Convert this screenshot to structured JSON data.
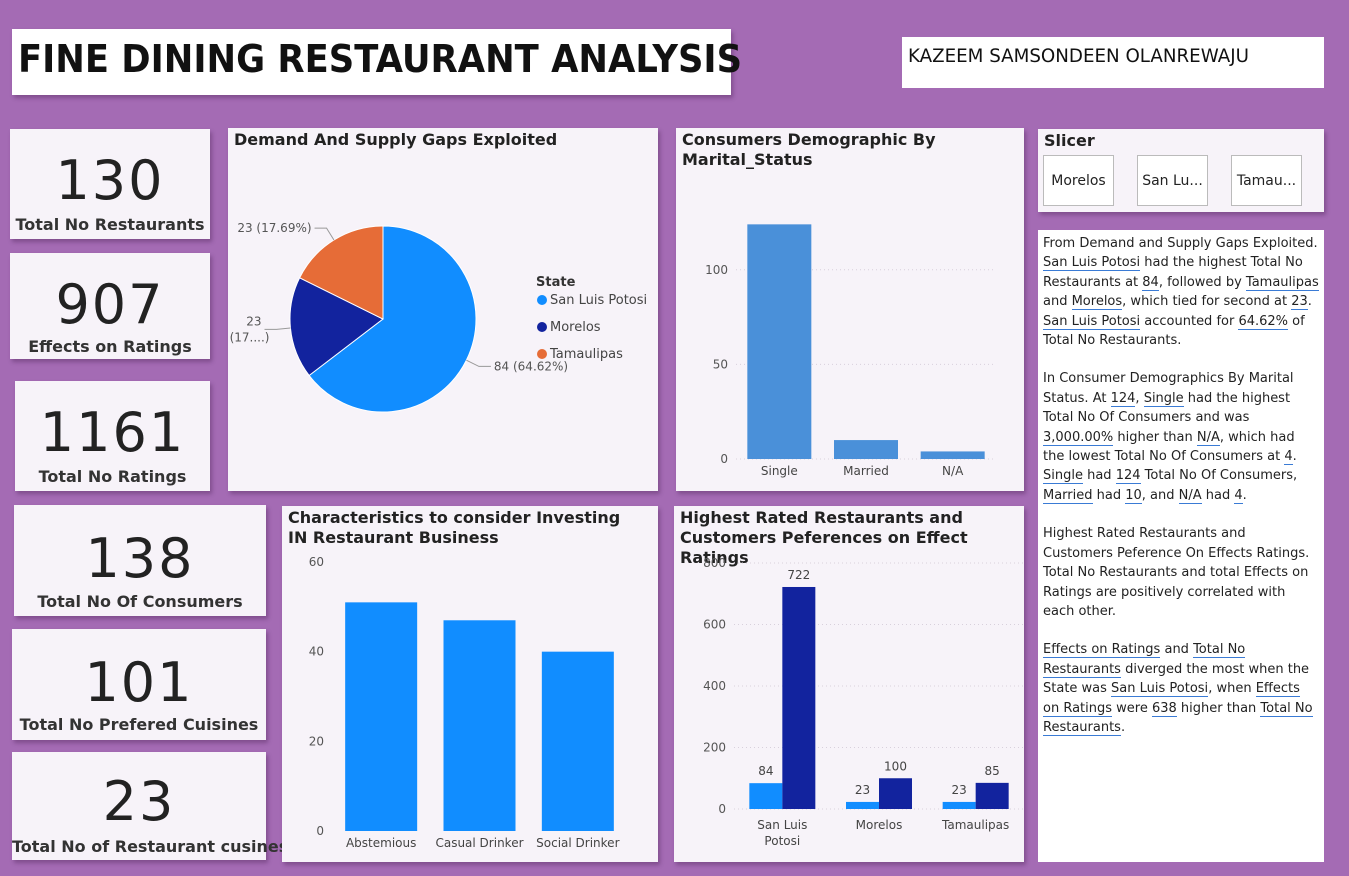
{
  "header": {
    "title": "FINE DINING RESTAURANT ANALYSIS",
    "author": "KAZEEM SAMSONDEEN OLANREWAJU"
  },
  "kpis": [
    {
      "value": "130",
      "label": "Total No Restaurants"
    },
    {
      "value": "907",
      "label": "Effects on Ratings"
    },
    {
      "value": "1161",
      "label": "Total No Ratings"
    },
    {
      "value": "138",
      "label": "Total No Of Consumers"
    },
    {
      "value": "101",
      "label": "Total No Prefered Cuisines"
    },
    {
      "value": "23",
      "label": "Total No of Restaurant cusines"
    }
  ],
  "slicer": {
    "title": "Slicer",
    "options": [
      "Morelos",
      "San Lu...",
      "Tamau..."
    ]
  },
  "chart_data": [
    {
      "type": "pie",
      "title": "Demand And Supply Gaps Exploited",
      "legend_title": "State",
      "legend_position": "right",
      "categories": [
        "San Luis Potosi",
        "Morelos",
        "Tamaulipas"
      ],
      "values": [
        84,
        23,
        23
      ],
      "data_labels": [
        "84 (64.62%)",
        "23 (17....)",
        "23 (17.69%)"
      ],
      "colors": [
        "#118dff",
        "#12239e",
        "#e66c37"
      ]
    },
    {
      "type": "bar",
      "title": "Consumers Demographic By Marital_Status",
      "categories": [
        "Single",
        "Married",
        "N/A"
      ],
      "values": [
        124,
        10,
        4
      ],
      "ylim": [
        0,
        130
      ],
      "yticks": [
        0,
        50,
        100
      ],
      "grid": true,
      "color": "#4a90d9"
    },
    {
      "type": "bar",
      "title": "Characteristics to consider Investing IN Restaurant Business",
      "categories": [
        "Abstemious",
        "Casual Drinker",
        "Social Drinker"
      ],
      "values": [
        51,
        47,
        40
      ],
      "ylim": [
        0,
        60
      ],
      "yticks": [
        0,
        20,
        40,
        60
      ],
      "grid": false,
      "color": "#118dff"
    },
    {
      "type": "bar",
      "title": "Highest Rated Restaurants and Customers Peferences on Effect Ratings",
      "categories": [
        "San Luis Potosi",
        "Morelos",
        "Tamaulipas"
      ],
      "series": [
        {
          "values": [
            84,
            23,
            23
          ],
          "color": "#118dff"
        },
        {
          "values": [
            722,
            100,
            85
          ],
          "color": "#12239e"
        }
      ],
      "ylim": [
        0,
        800
      ],
      "yticks": [
        0,
        200,
        400,
        600,
        800
      ],
      "grid": true
    }
  ],
  "narrative": {
    "p1": [
      "From Demand and Supply Gaps Exploited. ",
      "San Luis Potosi",
      " had the highest Total No Restaurants at ",
      "84",
      ", followed by ",
      "Tamaulipas",
      " and ",
      "Morelos",
      ", which tied for second at ",
      "23",
      ". ",
      "San Luis Potosi",
      " accounted for ",
      "64.62%",
      " of Total No Restaurants."
    ],
    "p2": [
      "In Consumer Demographics By Marital Status. At ",
      "124",
      ", ",
      "Single",
      " had the highest Total No Of Consumers and was ",
      "3,000.00%",
      " higher than ",
      "N/A",
      ", which had the lowest Total No Of Consumers at ",
      "4",
      ".\n",
      "Single",
      " had ",
      "124",
      " Total No Of Consumers, ",
      "Married",
      " had ",
      "10",
      ", and ",
      "N/A",
      " had ",
      "4",
      "."
    ],
    "p3": [
      "Highest Rated Restaurants and Customers Peference On Effects Ratings.\nTotal No Restaurants and total Effects on Ratings are positively correlated with each other."
    ],
    "p4": [
      "Effects on Ratings",
      " and ",
      "Total No Restaurants",
      " diverged the most when the State was ",
      "San Luis Potosi",
      ", when ",
      "Effects on Ratings",
      " were ",
      "638",
      " higher than ",
      "Total No Restaurants",
      "."
    ]
  }
}
